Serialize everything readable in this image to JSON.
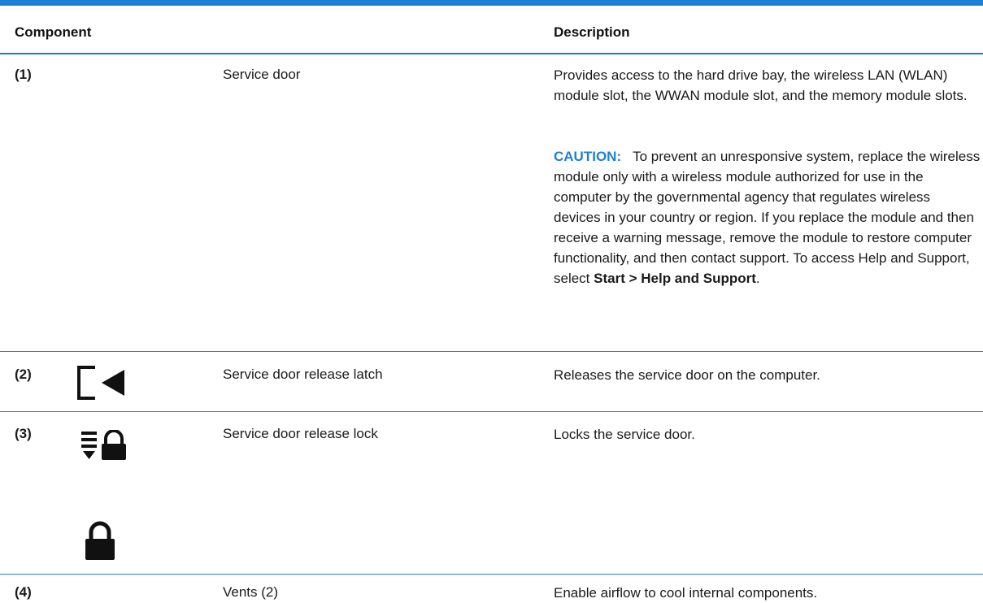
{
  "table": {
    "headers": {
      "component": "Component",
      "description": "Description"
    },
    "rows": [
      {
        "num": "(1)",
        "component": "Service door",
        "description": "Provides access to the hard drive bay, the wireless LAN (WLAN) module slot, the WWAN module slot, and the memory module slots.",
        "caution_label": "CAUTION:",
        "caution_text": "To prevent an unresponsive system, replace the wireless module only with a wireless module authorized for use in the computer by the governmental agency that regulates wireless devices in your country or region. If you replace the module and then receive a warning message, remove the module to restore computer functionality, and then contact support. To access Help and Support, select ",
        "caution_bold": "Start > Help and Support",
        "caution_end": "."
      },
      {
        "num": "(2)",
        "icon": "door-release-latch-icon",
        "component": "Service door release latch",
        "description": "Releases the service door on the computer."
      },
      {
        "num": "(3)",
        "icons": [
          "release-lock-icon",
          "padlock-icon"
        ],
        "component": "Service door release lock",
        "description": "Locks the service door."
      },
      {
        "num": "(4)",
        "component": "Vents (2)",
        "description": "Enable airflow to cool internal components."
      }
    ]
  },
  "colors": {
    "accent": "#1f7fd6",
    "rule": "#2d7fd1",
    "text": "#1a1a1a"
  }
}
